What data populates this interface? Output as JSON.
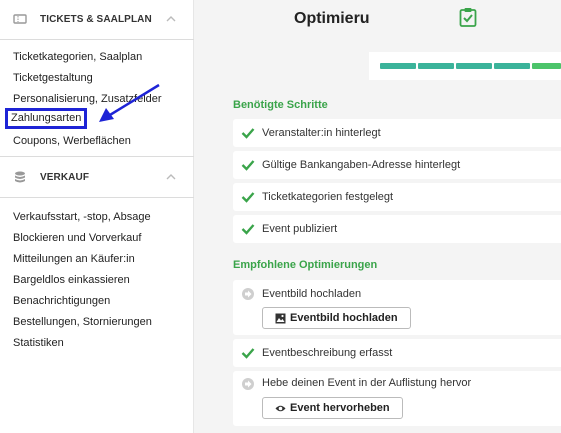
{
  "sidebar": {
    "tickets_section": {
      "title": "TICKETS & SAALPLAN",
      "items": [
        {
          "label": "Ticketkategorien, Saalplan"
        },
        {
          "label": "Ticketgestaltung"
        },
        {
          "label": "Personalisierung, Zusatzfelder"
        },
        {
          "label": "Zahlungsarten"
        },
        {
          "label": "Coupons, Werbeflächen"
        }
      ]
    },
    "sales_section": {
      "title": "VERKAUF",
      "items": [
        {
          "label": "Verkaufsstart, -stop, Absage"
        },
        {
          "label": "Blockieren und Vorverkauf"
        },
        {
          "label": "Mitteilungen an Käufer:in"
        },
        {
          "label": "Bargeldlos einkassieren"
        },
        {
          "label": "Benachrichtigungen"
        },
        {
          "label": "Bestellungen, Stornierungen"
        },
        {
          "label": "Statistiken"
        }
      ]
    }
  },
  "main": {
    "title": "Optimieru",
    "progress_colors": [
      "#3bb39a",
      "#3bb39a",
      "#3bb39a",
      "#3bb39a",
      "#4cc46a",
      "#4cc46a"
    ],
    "required_label": "Benötigte Schritte",
    "required_steps": [
      {
        "label": "Veranstalter:in hinterlegt"
      },
      {
        "label": "Gültige Bankangaben-Adresse hinterlegt"
      },
      {
        "label": "Ticketkategorien festgelegt"
      },
      {
        "label": "Event publiziert"
      }
    ],
    "recommended_label": "Empfohlene Optimierungen",
    "recommended": [
      {
        "label": "Eventbild hochladen",
        "button": "Eventbild hochladen"
      },
      {
        "label": "Eventbeschreibung erfasst"
      },
      {
        "label": "Hebe deinen Event in der Auflistung hervor",
        "button": "Event hervorheben"
      }
    ]
  },
  "colors": {
    "accent_green": "#3aa44a",
    "highlight_blue": "#1e24d6"
  }
}
